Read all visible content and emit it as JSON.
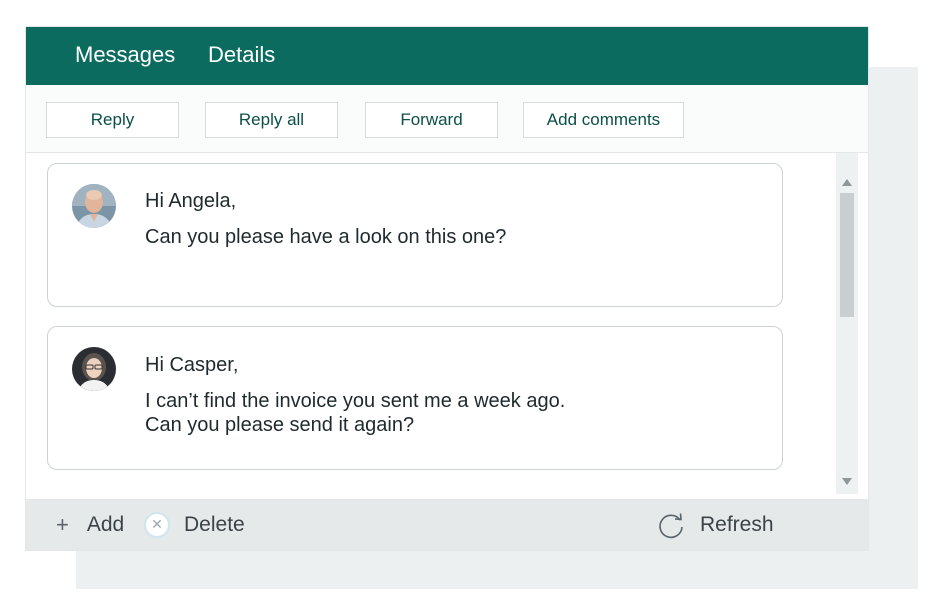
{
  "tabs": {
    "messages": "Messages",
    "details": "Details"
  },
  "toolbar": {
    "reply": "Reply",
    "reply_all": "Reply all",
    "forward": "Forward",
    "add_comments": "Add comments"
  },
  "messages": [
    {
      "avatar_icon": "bald-man-avatar",
      "lines": [
        "Hi Angela,",
        "Can you please have a look on this one?"
      ]
    },
    {
      "avatar_icon": "woman-glasses-avatar",
      "lines": [
        "Hi Casper,",
        "I can’t find the invoice you sent me a week ago.",
        "Can you please send it again?"
      ]
    }
  ],
  "footer": {
    "add": "Add",
    "delete": "Delete",
    "refresh": "Refresh"
  },
  "icons": {
    "add": "plus-icon",
    "delete": "close-circle-icon",
    "refresh": "refresh-icon",
    "scroll_up": "triangle-up-icon",
    "scroll_down": "triangle-down-icon"
  },
  "colors": {
    "header": "#0b6b5f",
    "button_text": "#0b4f47",
    "footer_bg": "#e6e9ea"
  }
}
